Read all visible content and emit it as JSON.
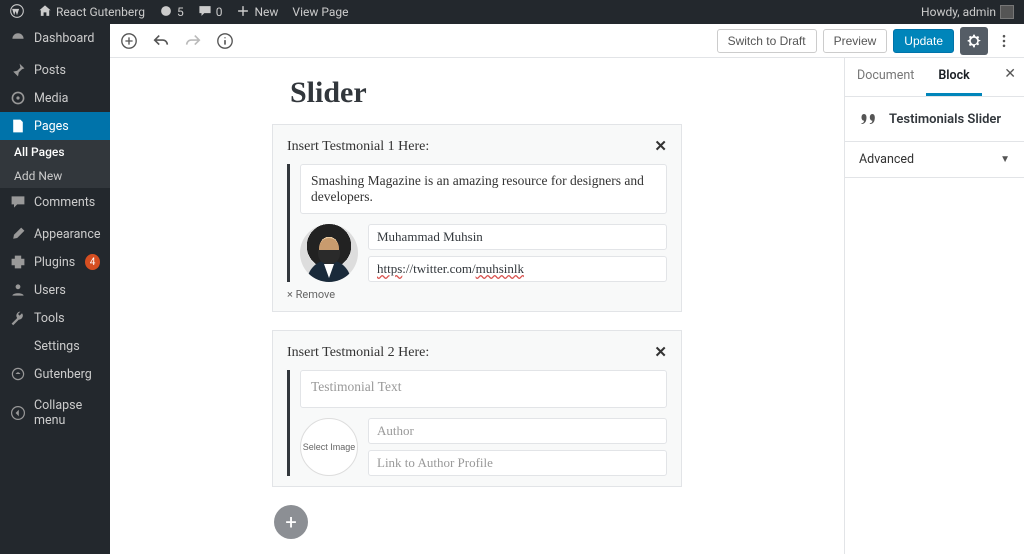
{
  "adminbar": {
    "site_name": "React Gutenberg",
    "updates_count": "5",
    "comments_count": "0",
    "new_label": "New",
    "view_label": "View Page",
    "howdy": "Howdy, admin"
  },
  "adminmenu": {
    "dashboard": "Dashboard",
    "posts": "Posts",
    "media": "Media",
    "pages": "Pages",
    "pages_sub_all": "All Pages",
    "pages_sub_add": "Add New",
    "comments": "Comments",
    "appearance": "Appearance",
    "plugins": "Plugins",
    "plugins_badge": "4",
    "users": "Users",
    "tools": "Tools",
    "settings": "Settings",
    "gutenberg": "Gutenberg",
    "collapse": "Collapse menu"
  },
  "editor": {
    "switch_draft": "Switch to Draft",
    "preview": "Preview",
    "update": "Update",
    "page_title": "Slider"
  },
  "testimonials": [
    {
      "header": "Insert Testmonial 1 Here:",
      "text": "Smashing Magazine is an amazing resource for designers and developers.",
      "has_image": true,
      "author": "Muhammad Muhsin",
      "link_prefix": "https",
      "link_mid": "://twitter.com/",
      "link_handle": "muhsinlk",
      "remove_label": "× Remove"
    },
    {
      "header": "Insert Testmonial 2 Here:",
      "text_placeholder": "Testimonial Text",
      "has_image": false,
      "select_image": "Select Image",
      "author_placeholder": "Author",
      "link_placeholder": "Link to Author Profile"
    }
  ],
  "rightside": {
    "tab_document": "Document",
    "tab_block": "Block",
    "block_name": "Testimonials Slider",
    "panel_advanced": "Advanced"
  }
}
